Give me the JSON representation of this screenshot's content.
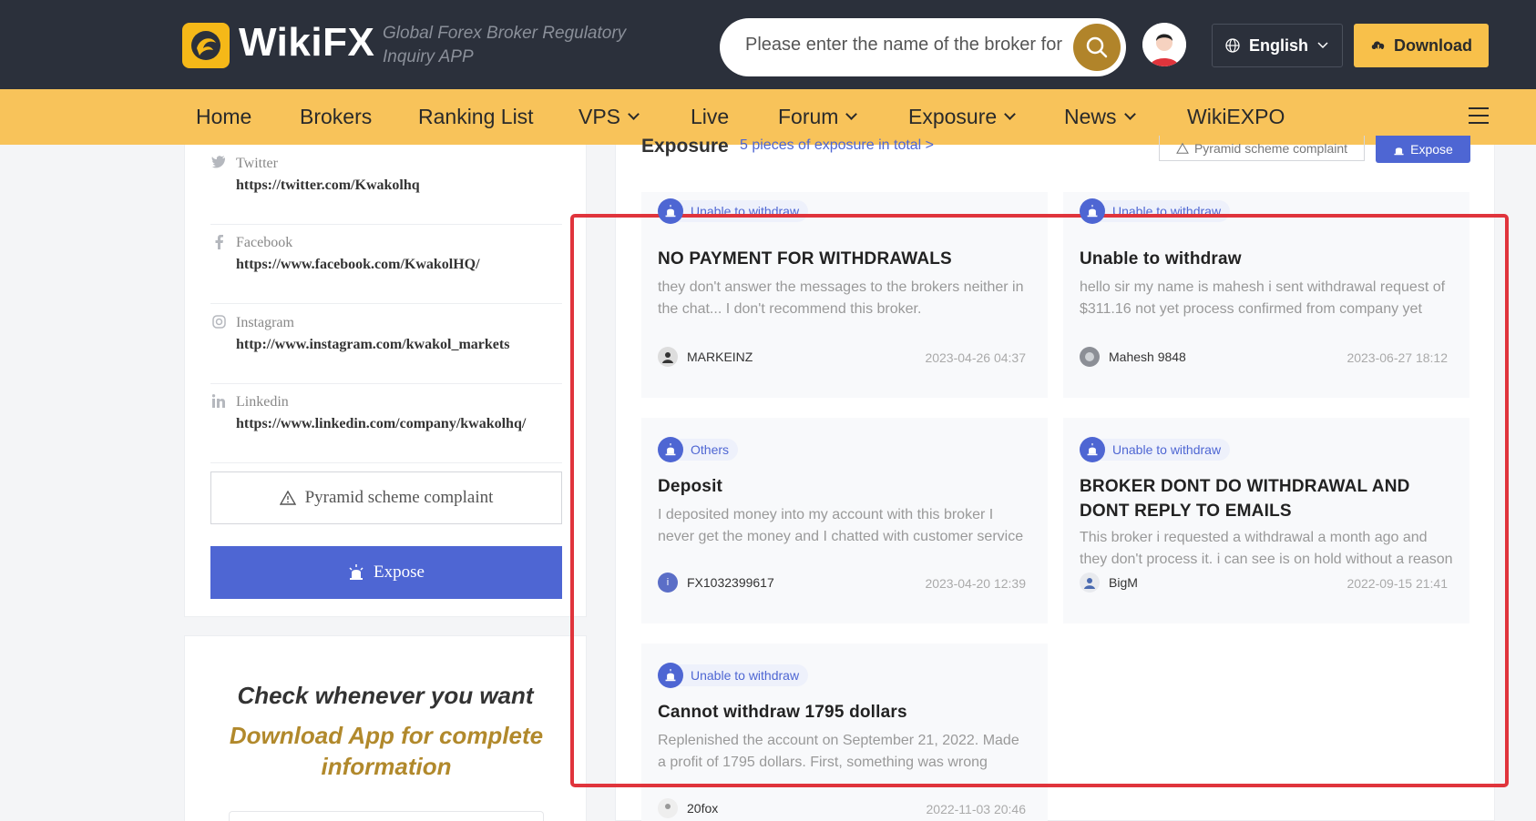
{
  "header": {
    "logo_text": "WikiFX",
    "tagline": "Global Forex Broker Regulatory Inquiry APP",
    "search_placeholder": "Please enter the name of the broker for ...",
    "language": "English",
    "download_label": "Download"
  },
  "nav": {
    "items": [
      "Home",
      "Brokers",
      "Ranking List",
      "VPS",
      "Live",
      "Forum",
      "Exposure",
      "News",
      "WikiEXPO"
    ]
  },
  "sidebar": {
    "socials": [
      {
        "label": "Twitter",
        "url": "https://twitter.com/Kwakolhq",
        "icon": "twitter-icon"
      },
      {
        "label": "Facebook",
        "url": "https://www.facebook.com/KwakolHQ/",
        "icon": "facebook-icon"
      },
      {
        "label": "Instagram",
        "url": "http://www.instagram.com/kwakol_markets",
        "icon": "instagram-icon"
      },
      {
        "label": "Linkedin",
        "url": "https://www.linkedin.com/company/kwakolhq/",
        "icon": "linkedin-icon"
      }
    ],
    "pyramid_label": "Pyramid scheme complaint",
    "expose_label": "Expose"
  },
  "promo": {
    "line1": "Check whenever you want",
    "line2": "Download App for complete information"
  },
  "exposure": {
    "title": "Exposure",
    "count_text": "5 pieces of exposure in total >",
    "pyramid_label": "Pyramid scheme complaint",
    "expose_label": "Expose",
    "cards": [
      {
        "tag": "Unable to withdraw",
        "title": "NO PAYMENT FOR WITHDRAWALS",
        "body": "they don't answer the messages to the brokers neither in the chat... I don't recommend this broker.",
        "user": "MARKEINZ",
        "date": "2023-04-26 04:37"
      },
      {
        "tag": "Unable to withdraw",
        "title": "Unable to withdraw",
        "body": "hello sir my name is mahesh i sent withdrawal request of $311.16 not yet process confirmed from company yet",
        "user": "Mahesh 9848",
        "date": "2023-06-27 18:12"
      },
      {
        "tag": "Others",
        "title": "Deposit",
        "body": "I deposited money into my account with this broker I never get the money and I chatted with customer service",
        "user": "FX1032399617",
        "date": "2023-04-20 12:39"
      },
      {
        "tag": "Unable to withdraw",
        "title": "BROKER DONT DO WITHDRAWAL AND DONT REPLY TO EMAILS",
        "body": "This broker i requested a withdrawal a month ago and they don't process it. i can see is on hold without a reason",
        "user": "BigM",
        "date": "2022-09-15 21:41"
      },
      {
        "tag": "Unable to withdraw",
        "title": "Cannot withdraw 1795 dollars",
        "body": "Replenished the account on September 21, 2022. Made a profit of 1795 dollars. First, something was wrong",
        "user": "20fox",
        "date": "2022-11-03 20:46"
      }
    ]
  },
  "colors": {
    "header_bg": "#2b303b",
    "nav_bg": "#f8c35a",
    "accent_blue": "#4e66d3",
    "gold": "#b1892c",
    "highlight_red": "#e0343c"
  }
}
